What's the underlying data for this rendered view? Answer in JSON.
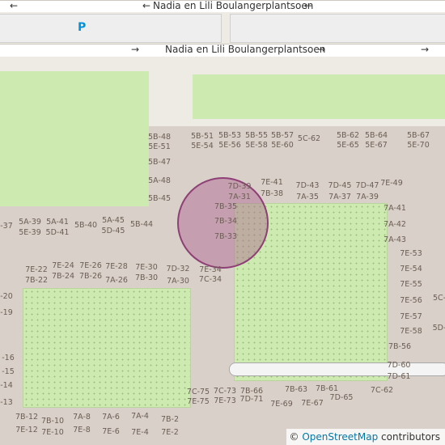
{
  "map": {
    "streets": {
      "top": "Nadia en Lili Boulangerplantsoen",
      "middle": "Nadia en Lili Boulangerplantsoen"
    },
    "parking_symbol": "P",
    "arrows": {
      "left": "←",
      "right": "→"
    },
    "attribution": {
      "copyright": "©",
      "link_text": "OpenStreetMap",
      "suffix": " contributors"
    },
    "house_numbers": [
      "5B-48",
      "5E-51",
      "5B-51",
      "5E-54",
      "5B-53",
      "5E-56",
      "5B-55",
      "5E-58",
      "5B-57",
      "5E-60",
      "5C-62",
      "5B-62",
      "5E-65",
      "5B-64",
      "5E-67",
      "5B-67",
      "5E-70",
      "5B-47",
      "5A-48",
      "5B-45",
      "7D-39",
      "7A-31",
      "7E-41",
      "7B-38",
      "7D-43",
      "7A-35",
      "7D-45",
      "7A-37",
      "7D-47",
      "7A-39",
      "7E-49",
      "7B-35",
      "7B-34",
      "7B-33",
      "7A-41",
      "7A-42",
      "7A-43",
      "5A-39",
      "5E-39",
      "5A-41",
      "5D-41",
      "5B-40",
      "5A-45",
      "5D-45",
      "5B-44",
      "7E-22",
      "7B-22",
      "7E-24",
      "7B-24",
      "7E-26",
      "7B-26",
      "7E-28",
      "7A-26",
      "7E-30",
      "7B-30",
      "7D-32",
      "7A-30",
      "7E-34",
      "7C-34",
      "7E-53",
      "7E-54",
      "7E-55",
      "7E-56",
      "7E-57",
      "7E-58",
      "7B-56",
      "7D-60",
      "7D-61",
      "7C-75",
      "7E-75",
      "7C-73",
      "7E-73",
      "7B-66",
      "7D-71",
      "7E-69",
      "7B-63",
      "7E-67",
      "7B-61",
      "7D-65",
      "7C-62",
      "7B-12",
      "7E-12",
      "7B-10",
      "7E-10",
      "7A-8",
      "7E-8",
      "7A-6",
      "7E-6",
      "7A-4",
      "7E-4",
      "7B-2",
      "7E-2",
      "-37",
      "-20",
      "-19",
      "-16",
      "-15",
      "-14",
      "-13",
      "5C-",
      "5D-"
    ]
  }
}
